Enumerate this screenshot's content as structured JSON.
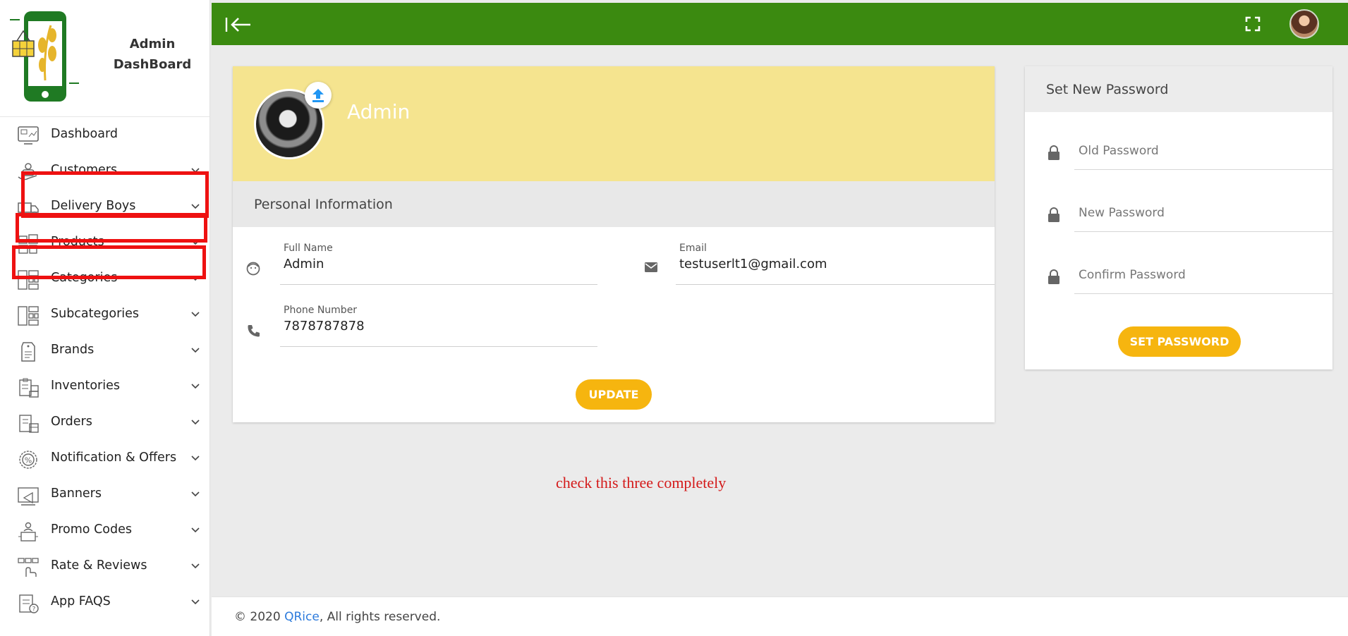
{
  "sidebar": {
    "brand_title_line1": "Admin",
    "brand_title_line2": "DashBoard",
    "items": [
      {
        "label": "Dashboard",
        "icon": "dashboard-icon",
        "has_chevron": false
      },
      {
        "label": "Customers",
        "icon": "customers-icon",
        "has_chevron": true
      },
      {
        "label": "Delivery Boys",
        "icon": "delivery-truck-icon",
        "has_chevron": true
      },
      {
        "label": "Products",
        "icon": "products-icon",
        "has_chevron": true
      },
      {
        "label": "Categories",
        "icon": "categories-icon",
        "has_chevron": true
      },
      {
        "label": "Subcategories",
        "icon": "subcategories-icon",
        "has_chevron": true
      },
      {
        "label": "Brands",
        "icon": "brands-tag-icon",
        "has_chevron": true
      },
      {
        "label": "Inventories",
        "icon": "inventories-icon",
        "has_chevron": true
      },
      {
        "label": "Orders",
        "icon": "orders-icon",
        "has_chevron": true
      },
      {
        "label": "Notification & Offers",
        "icon": "percent-badge-icon",
        "has_chevron": true
      },
      {
        "label": "Banners",
        "icon": "banners-icon",
        "has_chevron": true
      },
      {
        "label": "Promo Codes",
        "icon": "promo-codes-icon",
        "has_chevron": true
      },
      {
        "label": "Rate & Reviews",
        "icon": "rate-reviews-icon",
        "has_chevron": true
      },
      {
        "label": "App FAQS",
        "icon": "faq-icon",
        "has_chevron": true
      }
    ]
  },
  "topbar": {
    "color": "#3b8a10",
    "collapse_icon": "collapse-sidebar-icon",
    "fullscreen_icon": "fullscreen-icon"
  },
  "profile": {
    "name": "Admin",
    "banner_color": "#f5e48f",
    "section_title": "Personal Information",
    "full_name_label": "Full Name",
    "full_name": "Admin",
    "email_label": "Email",
    "email": "testuserlt1@gmail.com",
    "phone_label": "Phone Number",
    "phone": "7878787878",
    "update_label": "UPDATE"
  },
  "password": {
    "title": "Set New Password",
    "old_placeholder": "Old Password",
    "new_placeholder": "New Password",
    "confirm_placeholder": "Confirm Password",
    "submit_label": "SET PASSWORD"
  },
  "annotation": "check this three completely",
  "footer": {
    "prefix": "© 2020 ",
    "link": "QRice",
    "suffix": ", All rights reserved."
  },
  "accent_color": "#f6b50f"
}
